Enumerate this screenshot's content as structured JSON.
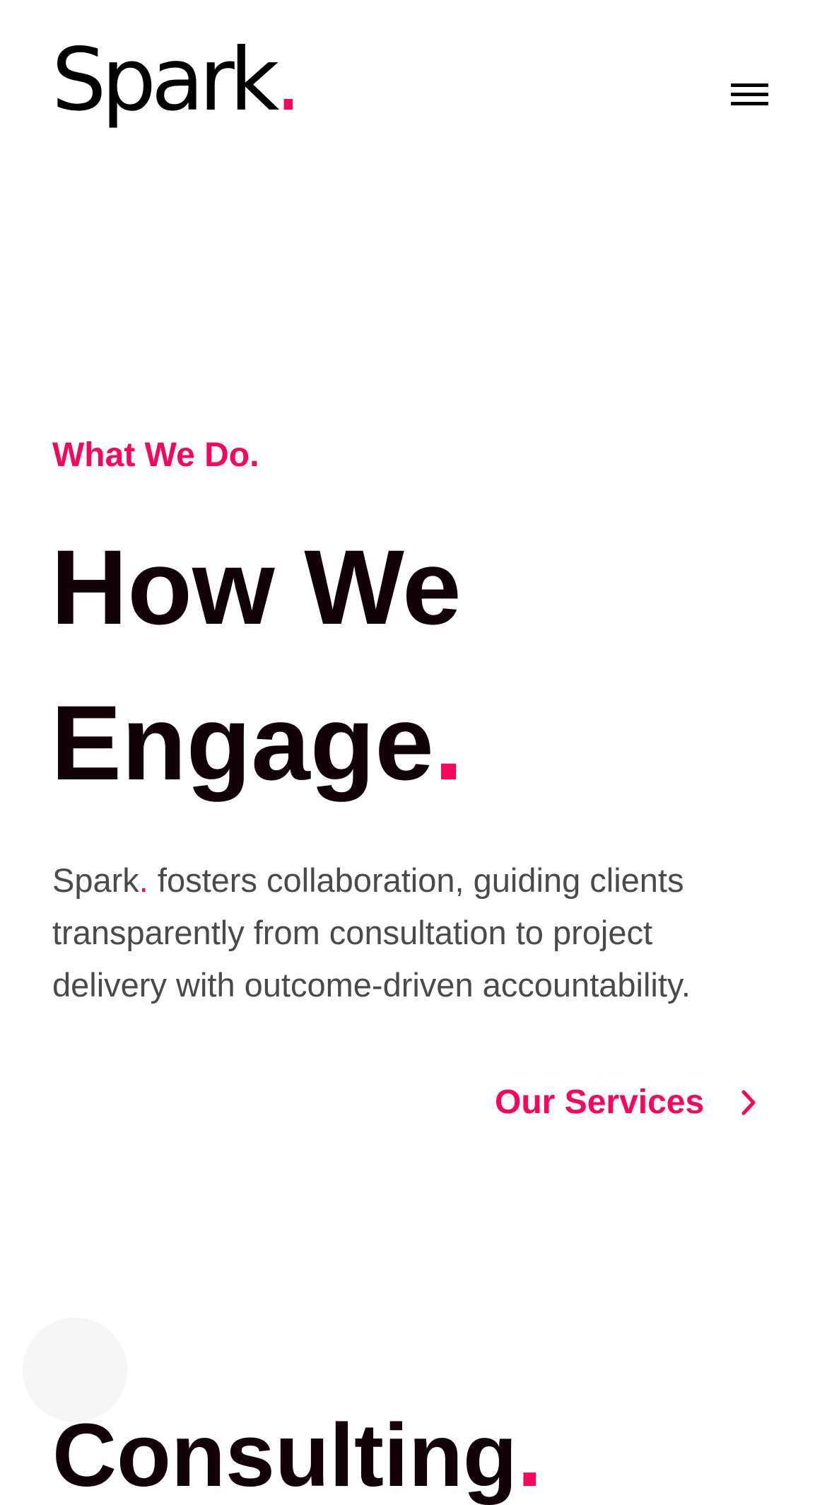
{
  "header": {
    "logo_text": "Spark",
    "logo_dot": ".",
    "menu_icon": "hamburger-menu-icon"
  },
  "hero": {
    "eyebrow": "What We Do.",
    "headline_line1": "How We",
    "headline_line2": "Engage",
    "headline_dot": ".",
    "paragraph_brand": "Spark",
    "paragraph_dot": ".",
    "paragraph_rest": " fosters collaboration, guiding clients transparently from consultation to project delivery with outcome-driven accountability.",
    "cta_label": "Our Services",
    "cta_icon": "chevron-right-icon"
  },
  "sections": {
    "consulting_title": "Consulting",
    "consulting_dot": "."
  },
  "colors": {
    "accent": "#f5075e",
    "heading": "#120309",
    "body_text": "#4a4a4a",
    "background": "#ffffff"
  }
}
